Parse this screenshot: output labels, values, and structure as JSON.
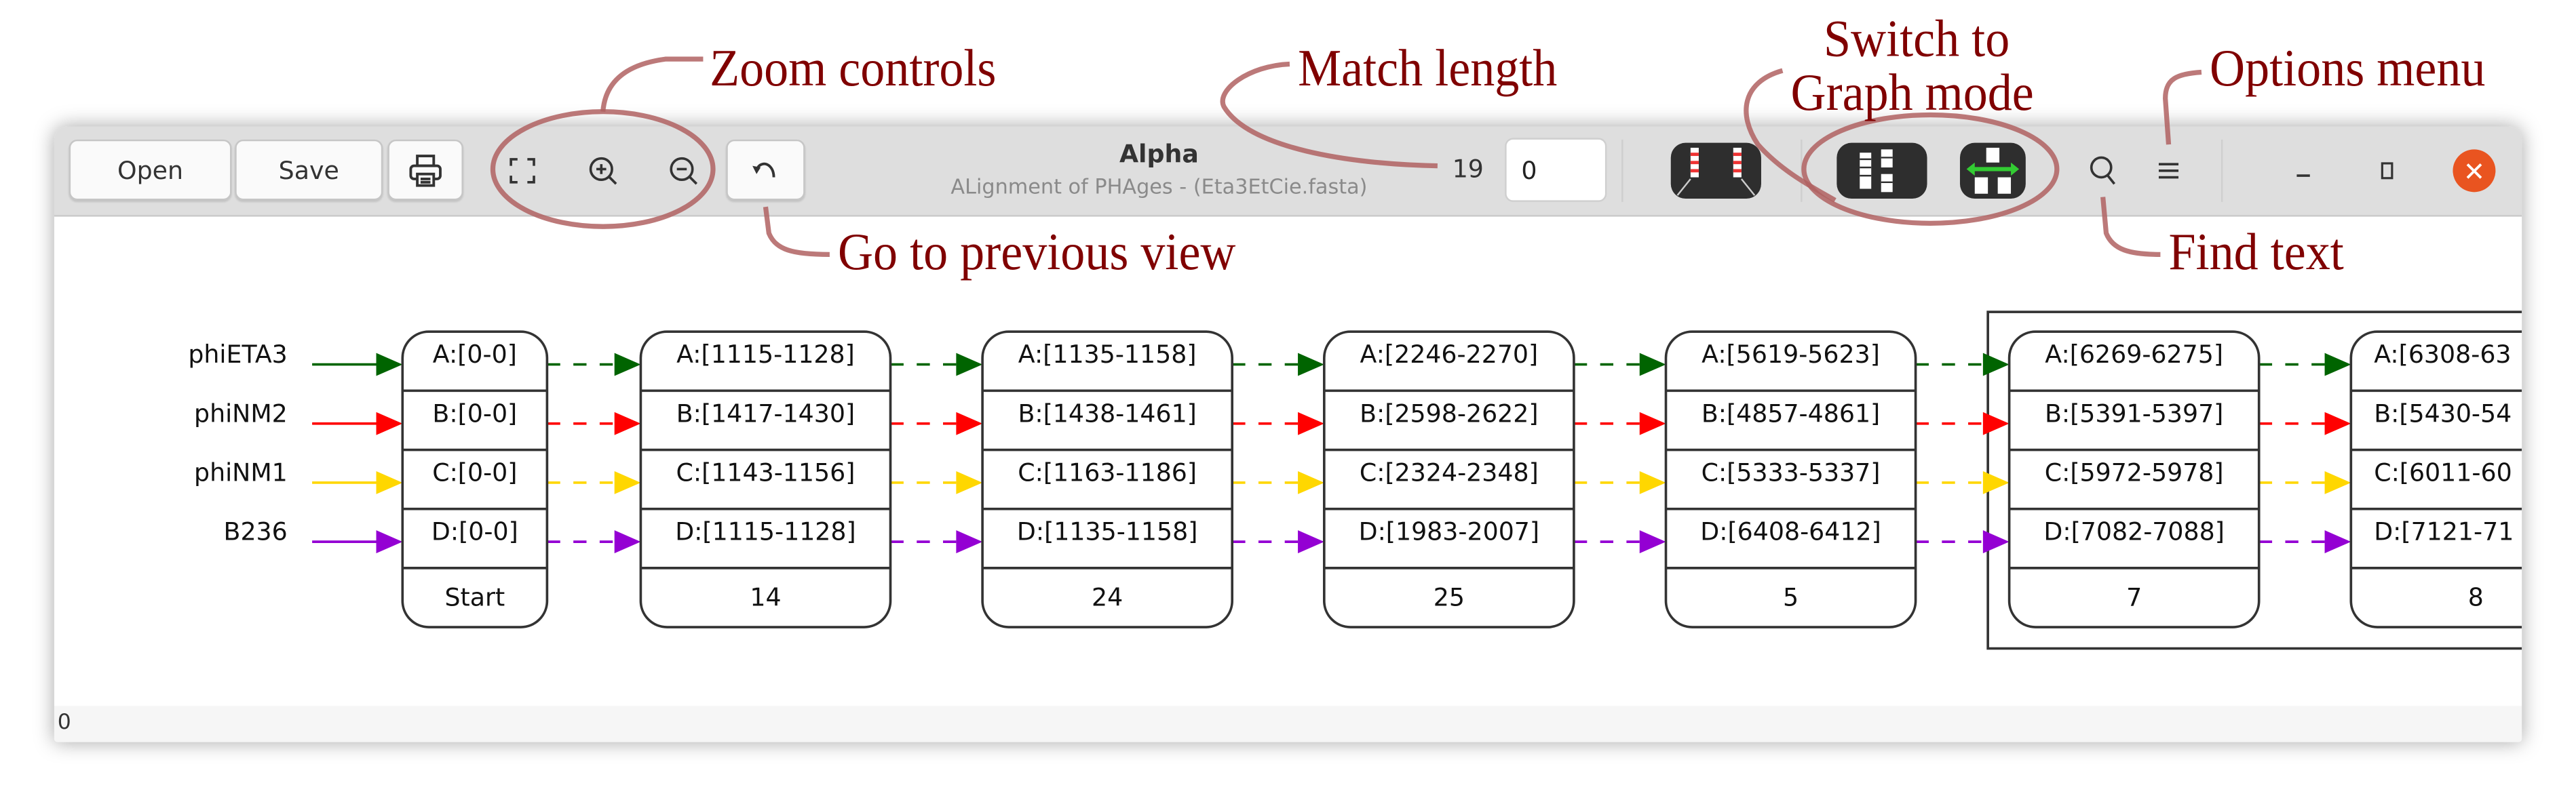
{
  "window": {
    "title": "Alpha",
    "subtitle": "ALignment of PHAges - (Eta3EtCie.fasta)",
    "status_text": "0"
  },
  "toolbar": {
    "open_label": "Open",
    "save_label": "Save",
    "print_icon": "printer-icon",
    "zoom_fit_icon": "zoom-fit-icon",
    "zoom_in_icon": "zoom-in-icon",
    "zoom_out_icon": "zoom-out-icon",
    "back_icon": "undo-arrow-icon",
    "match_length_count": "19",
    "match_length_value": "0",
    "close_glyph": "✕",
    "accent_close": "#e95420"
  },
  "annotations": {
    "zoom_controls": "Zoom controls",
    "match_length": "Match length",
    "switch_graph_line1": "Switch to",
    "switch_graph_line2": "Graph mode",
    "options_menu": "Options menu",
    "previous_view": "Go to previous view",
    "find_text": "Find text",
    "color": "#800000"
  },
  "graph": {
    "sequences": [
      {
        "name": "phiETA3",
        "color": "#006400"
      },
      {
        "name": "phiNM2",
        "color": "#ff0000"
      },
      {
        "name": "phiNM1",
        "color": "#ffd700"
      },
      {
        "name": "B236",
        "color": "#9400d3"
      }
    ],
    "nodes": [
      {
        "label": "Start",
        "rows": [
          "A:[0-0]",
          "B:[0-0]",
          "C:[0-0]",
          "D:[0-0]"
        ]
      },
      {
        "label": "14",
        "rows": [
          "A:[1115-1128]",
          "B:[1417-1430]",
          "C:[1143-1156]",
          "D:[1115-1128]"
        ]
      },
      {
        "label": "24",
        "rows": [
          "A:[1135-1158]",
          "B:[1438-1461]",
          "C:[1163-1186]",
          "D:[1135-1158]"
        ]
      },
      {
        "label": "25",
        "rows": [
          "A:[2246-2270]",
          "B:[2598-2622]",
          "C:[2324-2348]",
          "D:[1983-2007]"
        ]
      },
      {
        "label": "5",
        "rows": [
          "A:[5619-5623]",
          "B:[4857-4861]",
          "C:[5333-5337]",
          "D:[6408-6412]"
        ]
      },
      {
        "label": "7",
        "rows": [
          "A:[6269-6275]",
          "B:[5391-5397]",
          "C:[5972-5978]",
          "D:[7082-7088]"
        ]
      },
      {
        "label": "8",
        "rows": [
          "A:[6308-63",
          "B:[5430-54",
          "C:[6011-60",
          "D:[7121-71"
        ]
      }
    ]
  }
}
